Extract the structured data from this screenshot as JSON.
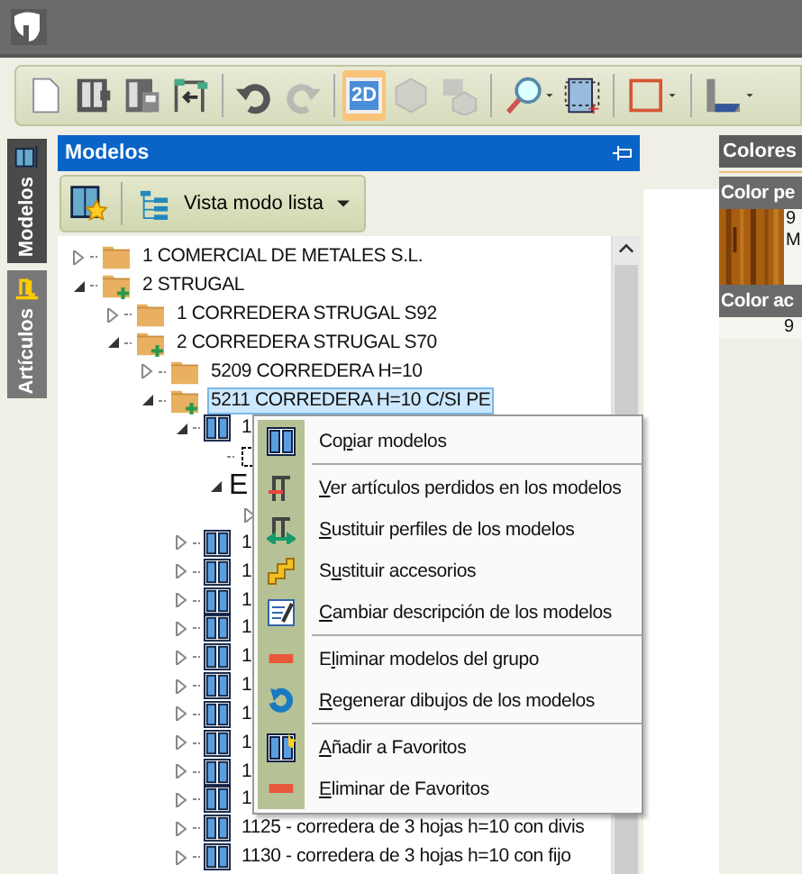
{
  "toolbar": [
    {
      "kind": "new",
      "disabled": false,
      "selected": false
    },
    {
      "kind": "save",
      "disabled": false,
      "selected": false
    },
    {
      "kind": "saveas",
      "disabled": false,
      "selected": false
    },
    {
      "kind": "import",
      "disabled": false,
      "selected": false
    },
    {
      "kind": "sep"
    },
    {
      "kind": "undo",
      "disabled": false,
      "selected": false
    },
    {
      "kind": "redo",
      "disabled": true,
      "selected": false
    },
    {
      "kind": "sep"
    },
    {
      "kind": "twod",
      "disabled": false,
      "selected": true,
      "label": "2D"
    },
    {
      "kind": "threed",
      "disabled": true,
      "selected": false
    },
    {
      "kind": "mixed",
      "disabled": true,
      "selected": false
    },
    {
      "kind": "sep"
    },
    {
      "kind": "zoom",
      "disabled": false,
      "selected": false
    },
    {
      "kind": "frame",
      "disabled": false,
      "selected": false
    },
    {
      "kind": "sep"
    },
    {
      "kind": "square",
      "disabled": false,
      "selected": false
    },
    {
      "kind": "sep"
    },
    {
      "kind": "corner",
      "disabled": false,
      "selected": false
    }
  ],
  "side_tabs": [
    {
      "label": "Modelos",
      "selected": true,
      "kind": "models"
    },
    {
      "label": "Artículos",
      "selected": false,
      "kind": "articles"
    }
  ],
  "panel": {
    "title": "Modelos",
    "view_button": "Vista modo lista"
  },
  "tree": [
    {
      "label": "1 COMERCIAL DE METALES S.L.",
      "kind": "folder",
      "expanded": false,
      "selected": false
    },
    {
      "label": "2 STRUGAL",
      "kind": "folder-plus",
      "expanded": true,
      "selected": false,
      "children": [
        {
          "label": "1 CORREDERA STRUGAL S92",
          "kind": "folder",
          "expanded": false,
          "selected": false
        },
        {
          "label": "2 CORREDERA STRUGAL S70",
          "kind": "folder-plus",
          "expanded": true,
          "selected": false,
          "children": [
            {
              "label": "5209 CORREDERA H=10",
              "kind": "folder",
              "expanded": false,
              "selected": false
            },
            {
              "label": "5211 CORREDERA H=10 C/SI PE",
              "kind": "folder-plus",
              "expanded": true,
              "selected": true,
              "children": [
                {
                  "label": "1",
                  "kind": "model",
                  "expanded": true,
                  "selected": false,
                  "children": [
                    {
                      "kind": "frame"
                    },
                    {
                      "label": "E",
                      "kind": "letter",
                      "expanded": true,
                      "selected": false,
                      "children": [
                        {
                          "expanded": false
                        }
                      ]
                    }
                  ]
                },
                {
                  "label": "1",
                  "kind": "model",
                  "expanded": false,
                  "selected": false
                },
                {
                  "label": "1",
                  "kind": "model",
                  "expanded": false,
                  "selected": false
                },
                {
                  "label": "1",
                  "kind": "model",
                  "expanded": false,
                  "selected": false
                },
                {
                  "label": "1",
                  "kind": "model",
                  "expanded": false,
                  "selected": false
                },
                {
                  "label": "1",
                  "kind": "model",
                  "expanded": false,
                  "selected": false
                },
                {
                  "label": "1",
                  "kind": "model",
                  "expanded": false,
                  "selected": false
                },
                {
                  "label": "1",
                  "kind": "model",
                  "expanded": false,
                  "selected": false
                },
                {
                  "label": "1",
                  "kind": "model",
                  "expanded": false,
                  "selected": false
                },
                {
                  "label": "1",
                  "kind": "model",
                  "expanded": false,
                  "selected": false
                },
                {
                  "label": "1",
                  "kind": "model",
                  "expanded": false,
                  "selected": false
                },
                {
                  "label": "1125 - corredera de 3 hojas h=10 con divis",
                  "kind": "model",
                  "expanded": false,
                  "selected": false
                },
                {
                  "label": "1130 - corredera de 3 hojas h=10 con fijo",
                  "kind": "model",
                  "expanded": false,
                  "selected": false
                }
              ]
            }
          ]
        }
      ]
    }
  ],
  "context_menu": [
    {
      "pre": "Co",
      "key": "p",
      "post": "iar modelos",
      "kind": "copy"
    },
    {
      "kind": "separator"
    },
    {
      "key": "V",
      "post": "er artículos perdidos en los modelos",
      "kind": "lost"
    },
    {
      "key": "S",
      "post": "ustituir perfiles de los modelos",
      "kind": "profiles"
    },
    {
      "pre": "S",
      "key": "u",
      "post": "stituir accesorios",
      "kind": "accessories"
    },
    {
      "key": "C",
      "post": "ambiar descripción de los modelos",
      "kind": "edit"
    },
    {
      "kind": "separator"
    },
    {
      "pre": "E",
      "key": "l",
      "post": "iminar modelos del grupo",
      "kind": "remove"
    },
    {
      "key": "R",
      "post": "egenerar dibujos de los modelos",
      "kind": "refresh"
    },
    {
      "kind": "separator"
    },
    {
      "key": "A",
      "post": "ñadir a Favoritos",
      "kind": "favorite"
    },
    {
      "key": "E",
      "post": "liminar de Favoritos",
      "kind": "remove"
    }
  ],
  "colors_panel": {
    "title": "Colores",
    "sections": [
      {
        "title": "Color pe",
        "lines": [
          "9",
          "M"
        ],
        "kind": "picture"
      },
      {
        "title": "Color ac",
        "lines": [
          "9"
        ],
        "kind": "text"
      }
    ]
  }
}
